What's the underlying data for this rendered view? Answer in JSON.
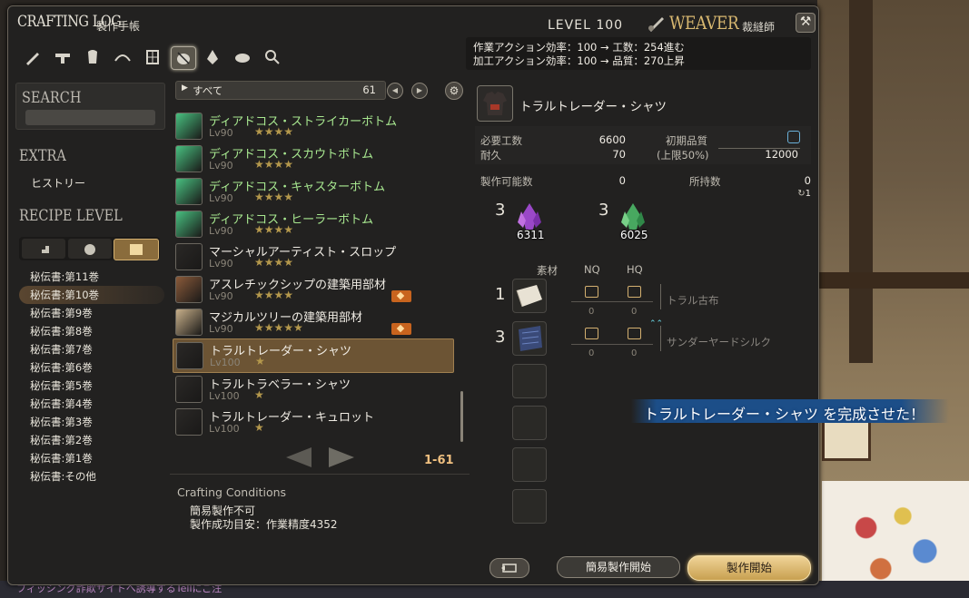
{
  "window": {
    "title_en": "CRAFTING LOG",
    "title_jp": "製作手帳",
    "level_label": "LEVEL 100",
    "job_name": "WEAVER",
    "job_jp": "裁縫師",
    "close_glyph": "⚒",
    "efficiency": {
      "line1": "作業アクション効率：100 → 工数：254進む",
      "line2": "加工アクション効率：100 → 品質：270上昇"
    }
  },
  "category_icons": [
    "carpenter-icon",
    "blacksmith-icon",
    "armorer-icon",
    "goldsmith-icon",
    "leatherworker-icon",
    "weaver-icon",
    "alchemist-icon",
    "culinarian-icon",
    "search-icon"
  ],
  "left": {
    "search_title": "SEARCH",
    "extra_title": "EXTRA",
    "history": "ヒストリー",
    "recipe_level_title": "RECIPE LEVEL",
    "recipe_levels": [
      "秘伝書:第11巻",
      "秘伝書:第10巻",
      "秘伝書:第9巻",
      "秘伝書:第8巻",
      "秘伝書:第7巻",
      "秘伝書:第6巻",
      "秘伝書:第5巻",
      "秘伝書:第4巻",
      "秘伝書:第3巻",
      "秘伝書:第2巻",
      "秘伝書:第1巻",
      "秘伝書:その他"
    ],
    "selected_index": 1
  },
  "center": {
    "filter_label": "すべて",
    "filter_count": "61",
    "recipes": [
      {
        "name": "ディアドコス・ストライカーボトム",
        "level": "Lv90",
        "stars": "★★★★",
        "green": true
      },
      {
        "name": "ディアドコス・スカウトボトム",
        "level": "Lv90",
        "stars": "★★★★",
        "green": true
      },
      {
        "name": "ディアドコス・キャスターボトム",
        "level": "Lv90",
        "stars": "★★★★",
        "green": true
      },
      {
        "name": "ディアドコス・ヒーラーボトム",
        "level": "Lv90",
        "stars": "★★★★",
        "green": true
      },
      {
        "name": "マーシャルアーティスト・スロップ",
        "level": "Lv90",
        "stars": "★★★★",
        "green": false
      },
      {
        "name": "アスレチックシップの建築用部材",
        "level": "Lv90",
        "stars": "★★★★",
        "green": false
      },
      {
        "name": "マジカルツリーの建築用部材",
        "level": "Lv90",
        "stars": "★★★★★",
        "green": false
      },
      {
        "name": "トラルトレーダー・シャツ",
        "level": "Lv100",
        "stars": "★",
        "green": false
      },
      {
        "name": "トラルトラベラー・シャツ",
        "level": "Lv100",
        "stars": "★",
        "green": false
      },
      {
        "name": "トラルトレーダー・キュロット",
        "level": "Lv100",
        "stars": "★",
        "green": false
      }
    ],
    "page_range": "1-61",
    "conditions_title": "Crafting Conditions",
    "conditions": [
      "簡易製作不可",
      "製作成功目安：作業精度4352"
    ]
  },
  "detail": {
    "item_name": "トラルトレーダー・シャツ",
    "required_progress_label": "必要工数",
    "required_progress": "6600",
    "durability_label": "耐久",
    "durability": "70",
    "initial_quality_label": "初期品質",
    "cap_label": "(上限50%)",
    "max_quality": "12000",
    "craftable_label": "製作可能数",
    "craftable": "0",
    "owned_label": "所持数",
    "owned": "0",
    "owned_sub": "1",
    "crystals": [
      {
        "name": "lightning-crystal-icon",
        "need": "3",
        "have": "6311"
      },
      {
        "name": "wind-crystal-icon",
        "need": "3",
        "have": "6025"
      }
    ],
    "mat_headers": {
      "material": "素材",
      "nq": "NQ",
      "hq": "HQ"
    },
    "materials": [
      {
        "count": "1",
        "nq": "0",
        "hq": "0",
        "name": "トラル古布"
      },
      {
        "count": "3",
        "nq": "0",
        "hq": "0",
        "name": "サンダーヤードシルク"
      }
    ],
    "quick_synth_label": "簡易製作開始",
    "synth_label": "製作開始"
  },
  "toast": "トラルトレーダー・シャツ を完成させた！",
  "chat": "フィッシング詐欺サイトへ誘導するTellにご注"
}
